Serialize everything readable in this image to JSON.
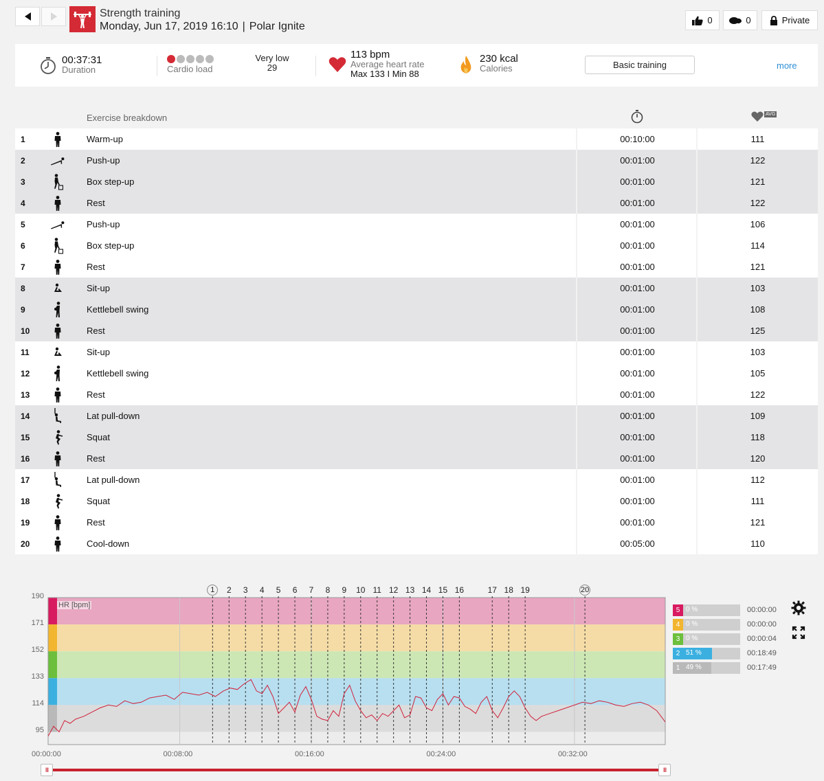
{
  "header": {
    "sport": "Strength training",
    "date": "Monday, Jun 17, 2019 16:10",
    "separator": "|",
    "device": "Polar Ignite",
    "likes": "0",
    "comments": "0",
    "privacy": "Private"
  },
  "summary": {
    "duration_value": "00:37:31",
    "duration_label": "Duration",
    "cardio_label": "Cardio load",
    "cardio_dots_filled": 1,
    "cardio_dots_total": 5,
    "load_level": "Very low",
    "load_value": "29",
    "hr_value": "113 bpm",
    "hr_label": "Average heart rate",
    "hr_minmax": "Max 133  I  Min 88",
    "calories_value": "230 kcal",
    "calories_label": "Calories",
    "benefit": "Basic training",
    "more": "more"
  },
  "table": {
    "title": "Exercise breakdown",
    "avg_badge": "AVG",
    "rows": [
      {
        "n": "1",
        "icon": "standing-person-icon",
        "name": "Warm-up",
        "time": "00:10:00",
        "hr": "111"
      },
      {
        "n": "2",
        "icon": "pushup-icon",
        "name": "Push-up",
        "time": "00:01:00",
        "hr": "122"
      },
      {
        "n": "3",
        "icon": "box-stepup-icon",
        "name": "Box step-up",
        "time": "00:01:00",
        "hr": "121"
      },
      {
        "n": "4",
        "icon": "standing-person-icon",
        "name": "Rest",
        "time": "00:01:00",
        "hr": "122"
      },
      {
        "n": "5",
        "icon": "pushup-icon",
        "name": "Push-up",
        "time": "00:01:00",
        "hr": "106"
      },
      {
        "n": "6",
        "icon": "box-stepup-icon",
        "name": "Box step-up",
        "time": "00:01:00",
        "hr": "114"
      },
      {
        "n": "7",
        "icon": "standing-person-icon",
        "name": "Rest",
        "time": "00:01:00",
        "hr": "121"
      },
      {
        "n": "8",
        "icon": "situp-icon",
        "name": "Sit-up",
        "time": "00:01:00",
        "hr": "103"
      },
      {
        "n": "9",
        "icon": "kettlebell-icon",
        "name": "Kettlebell swing",
        "time": "00:01:00",
        "hr": "108"
      },
      {
        "n": "10",
        "icon": "standing-person-icon",
        "name": "Rest",
        "time": "00:01:00",
        "hr": "125"
      },
      {
        "n": "11",
        "icon": "situp-icon",
        "name": "Sit-up",
        "time": "00:01:00",
        "hr": "103"
      },
      {
        "n": "12",
        "icon": "kettlebell-icon",
        "name": "Kettlebell swing",
        "time": "00:01:00",
        "hr": "105"
      },
      {
        "n": "13",
        "icon": "standing-person-icon",
        "name": "Rest",
        "time": "00:01:00",
        "hr": "122"
      },
      {
        "n": "14",
        "icon": "lat-pulldown-icon",
        "name": "Lat pull-down",
        "time": "00:01:00",
        "hr": "109"
      },
      {
        "n": "15",
        "icon": "squat-icon",
        "name": "Squat",
        "time": "00:01:00",
        "hr": "118"
      },
      {
        "n": "16",
        "icon": "standing-person-icon",
        "name": "Rest",
        "time": "00:01:00",
        "hr": "120"
      },
      {
        "n": "17",
        "icon": "lat-pulldown-icon",
        "name": "Lat pull-down",
        "time": "00:01:00",
        "hr": "112"
      },
      {
        "n": "18",
        "icon": "squat-icon",
        "name": "Squat",
        "time": "00:01:00",
        "hr": "111"
      },
      {
        "n": "19",
        "icon": "standing-person-icon",
        "name": "Rest",
        "time": "00:01:00",
        "hr": "121"
      },
      {
        "n": "20",
        "icon": "standing-person-icon",
        "name": "Cool-down",
        "time": "00:05:00",
        "hr": "110"
      }
    ]
  },
  "chart_data": {
    "type": "line",
    "ylabel": "HR [bpm]",
    "yticks": [
      190,
      171,
      152,
      133,
      114,
      95
    ],
    "ylim": [
      86,
      190
    ],
    "xticks": [
      "00:00:00",
      "00:08:00",
      "00:16:00",
      "00:24:00",
      "00:32:00"
    ],
    "xlim_seconds": [
      0,
      2251
    ],
    "zones_bpm": [
      {
        "zone": 5,
        "from": 171,
        "to": 190,
        "color": "#e8a6c0",
        "bar_color": "#d81b60"
      },
      {
        "zone": 4,
        "from": 152,
        "to": 171,
        "color": "#f5dca6",
        "bar_color": "#f2b530"
      },
      {
        "zone": 3,
        "from": 133,
        "to": 152,
        "color": "#cce7b4",
        "bar_color": "#6cbf3c"
      },
      {
        "zone": 2,
        "from": 114,
        "to": 133,
        "color": "#b7dff0",
        "bar_color": "#3bb0e0"
      },
      {
        "zone": 1,
        "from": 95,
        "to": 114,
        "color": "#dcdcdc",
        "bar_color": "#b9b9b9"
      }
    ],
    "exercise_markers": [
      {
        "label": "1",
        "t": 600
      },
      {
        "label": "2",
        "t": 660
      },
      {
        "label": "3",
        "t": 720
      },
      {
        "label": "4",
        "t": 780
      },
      {
        "label": "5",
        "t": 840
      },
      {
        "label": "6",
        "t": 900
      },
      {
        "label": "7",
        "t": 960
      },
      {
        "label": "8",
        "t": 1020
      },
      {
        "label": "9",
        "t": 1080
      },
      {
        "label": "10",
        "t": 1140
      },
      {
        "label": "11",
        "t": 1200
      },
      {
        "label": "12",
        "t": 1260
      },
      {
        "label": "13",
        "t": 1320
      },
      {
        "label": "14",
        "t": 1380
      },
      {
        "label": "15",
        "t": 1440
      },
      {
        "label": "16",
        "t": 1500
      },
      {
        "label": "17",
        "t": 1620
      },
      {
        "label": "18",
        "t": 1680
      },
      {
        "label": "19",
        "t": 1740
      },
      {
        "label": "20",
        "t": 1958
      }
    ],
    "series": [
      {
        "name": "HR [bpm]",
        "t": [
          0,
          20,
          40,
          60,
          80,
          100,
          130,
          160,
          190,
          220,
          250,
          280,
          310,
          340,
          370,
          400,
          430,
          460,
          490,
          520,
          550,
          580,
          610,
          640,
          665,
          690,
          715,
          740,
          760,
          780,
          800,
          820,
          840,
          860,
          880,
          900,
          920,
          940,
          960,
          980,
          1000,
          1020,
          1040,
          1060,
          1080,
          1100,
          1120,
          1140,
          1160,
          1180,
          1200,
          1220,
          1240,
          1260,
          1280,
          1300,
          1320,
          1340,
          1360,
          1380,
          1400,
          1420,
          1440,
          1460,
          1480,
          1500,
          1520,
          1540,
          1560,
          1580,
          1600,
          1620,
          1640,
          1660,
          1680,
          1700,
          1720,
          1740,
          1760,
          1780,
          1800,
          1830,
          1860,
          1890,
          1920,
          1950,
          1980,
          2010,
          2040,
          2070,
          2100,
          2130,
          2160,
          2190,
          2220,
          2251
        ],
        "values": [
          92,
          99,
          95,
          103,
          101,
          104,
          106,
          109,
          112,
          114,
          113,
          117,
          115,
          116,
          119,
          120,
          121,
          118,
          123,
          122,
          121,
          123,
          120,
          124,
          126,
          125,
          129,
          132,
          124,
          122,
          128,
          120,
          108,
          112,
          116,
          109,
          121,
          127,
          118,
          106,
          104,
          103,
          110,
          106,
          122,
          128,
          117,
          110,
          105,
          107,
          103,
          108,
          106,
          110,
          114,
          105,
          107,
          120,
          119,
          112,
          110,
          118,
          122,
          114,
          120,
          119,
          113,
          111,
          108,
          116,
          120,
          110,
          105,
          112,
          120,
          124,
          120,
          112,
          106,
          103,
          106,
          108,
          110,
          112,
          114,
          116,
          115,
          117,
          116,
          114,
          113,
          115,
          116,
          114,
          110,
          102
        ]
      }
    ]
  },
  "zones": [
    {
      "num": "5",
      "pct": "0 %",
      "fill": 0,
      "time": "00:00:00"
    },
    {
      "num": "4",
      "pct": "0 %",
      "fill": 0,
      "time": "00:00:00"
    },
    {
      "num": "3",
      "pct": "0 %",
      "fill": 0,
      "time": "00:00:04"
    },
    {
      "num": "2",
      "pct": "51 %",
      "fill": 0.51,
      "time": "00:18:49"
    },
    {
      "num": "1",
      "pct": "49 %",
      "fill": 0.49,
      "time": "00:17:49"
    }
  ],
  "slider": {
    "handle_glyph": "III"
  }
}
